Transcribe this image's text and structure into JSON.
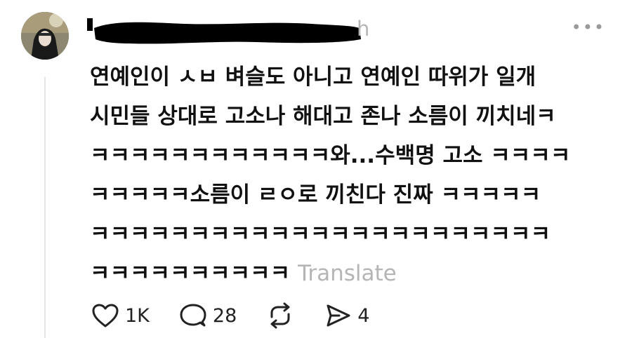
{
  "post": {
    "timestamp_fragment": "h",
    "more_icon": "more-dots-icon",
    "lines": [
      "연예인이 ㅅㅂ 벼슬도 아니고 연예인 따위가 일개",
      "시민들 상대로 고소나 해대고 존나 소름이 끼치네ㅋ",
      "ㅋㅋㅋㅋㅋㅋㅋㅋㅋㅋㅋㅋ와...수백명 고소 ㅋㅋㅋㅋ",
      "ㅋㅋㅋㅋㅋ소름이 ㄹㅇ로 끼친다 진짜 ㅋㅋㅋㅋㅋ",
      "ㅋㅋㅋㅋㅋㅋㅋㅋㅋㅋㅋㅋㅋㅋㅋㅋㅋㅋㅋㅋㅋㅋㅋ",
      "ㅋㅋㅋㅋㅋㅋㅋㅋㅋㅋ "
    ],
    "translate_label": "Translate"
  },
  "actions": {
    "likes": {
      "icon": "heart-icon",
      "count": "1K"
    },
    "replies": {
      "icon": "reply-bubble-icon",
      "count": "28"
    },
    "reposts": {
      "icon": "repost-icon"
    },
    "shares": {
      "icon": "send-icon",
      "count": "4"
    }
  },
  "colors": {
    "text": "#111111",
    "muted": "#b5b5b5",
    "thread_line": "#e6e6e6",
    "redaction": "#000000"
  }
}
